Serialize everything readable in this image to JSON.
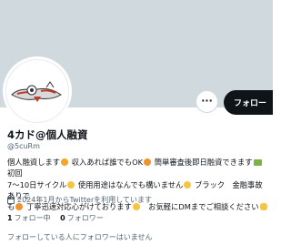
{
  "profile": {
    "display_name": "4カド@個人融資",
    "handle": "@5cuRm",
    "bio": {
      "line1_a": "個人融資します",
      "line1_b": " 収入あれば誰でもOK",
      "line1_c": " 簡単審査後即日融資できます",
      "line1_d": " 初回",
      "line2_a": "7〜10日サイクル",
      "line2_b": " 使用用途はなんでも構いません",
      "line2_c": " ブラック　金融事故ありで",
      "line3_a": "も",
      "line3_b": " 丁寧迅速対応心がけております",
      "line3_c": "　お気軽にDMまでご相談ください"
    },
    "joined": "2024年1月からTwitterを利用しています",
    "following_count": "1",
    "following_label": "フォロー中",
    "followers_count": "0",
    "followers_label": "フォロワー",
    "followers_note": "フォローしている人にフォロワーはいません"
  },
  "actions": {
    "more_label": "···",
    "follow_label": "フォロー"
  },
  "colors": {
    "banner": "#cfd9de",
    "follow_button_bg": "#0f1419",
    "secondary_text": "#536471"
  },
  "icons": [
    "more-icon",
    "calendar-icon",
    "avatar-image"
  ]
}
